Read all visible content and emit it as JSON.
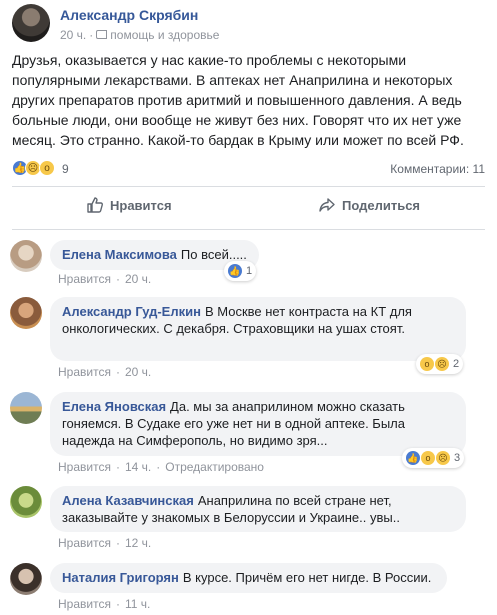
{
  "post": {
    "author": "Александр Скрябин",
    "time": "20 ч.",
    "category": "помощь и здоровье",
    "text": "Друзья, оказывается у нас какие-то проблемы с некоторыми популярными лекарствами. В аптеках нет Анаприлина и некоторых других препаратов против аритмий и повышенного давления. А ведь больные люди, они вообще не живут без них. Говорят что их нет уже месяц. Это странно. Какой-то бардак в Крыму или может по всей РФ.",
    "reactions_count": "9",
    "comments_label": "Комментарии: 11"
  },
  "actions": {
    "like": "Нравится",
    "share": "Поделиться"
  },
  "comments": [
    {
      "name": "Елена Максимова",
      "text": "По всей.....",
      "like": "Нравится",
      "time": "20 ч.",
      "reactions": "1",
      "edited": ""
    },
    {
      "name": "Александр Гуд-Елкин",
      "text": "В Москве нет контраста на КТ для онкологических. С декабря. Страховщики на ушах стоят.",
      "like": "Нравится",
      "time": "20 ч.",
      "reactions": "2",
      "edited": ""
    },
    {
      "name": "Елена Яновская",
      "text": "Да. мы за анаприлином можно сказать гоняемся. В Судаке его уже нет ни в одной аптеке. Была надежда на Симферополь, но видимо зря...",
      "like": "Нравится",
      "time": "14 ч.",
      "reactions": "3",
      "edited": "Отредактировано"
    },
    {
      "name": "Алена Казавчинская",
      "text": "Анаприлина по всей стране нет, заказывайте у знакомых в Белоруссии и Украине.. увы..",
      "like": "Нравится",
      "time": "12 ч.",
      "reactions": "",
      "edited": ""
    },
    {
      "name": "Наталия Григорян",
      "text": "В курсе. Причём его нет нигде. В России.",
      "like": "Нравится",
      "time": "11 ч.",
      "reactions": "",
      "edited": ""
    }
  ],
  "colors": {
    "name_link": "#385898",
    "like_blue": "#4a7bd1",
    "bubble_bg": "#f2f3f5"
  }
}
